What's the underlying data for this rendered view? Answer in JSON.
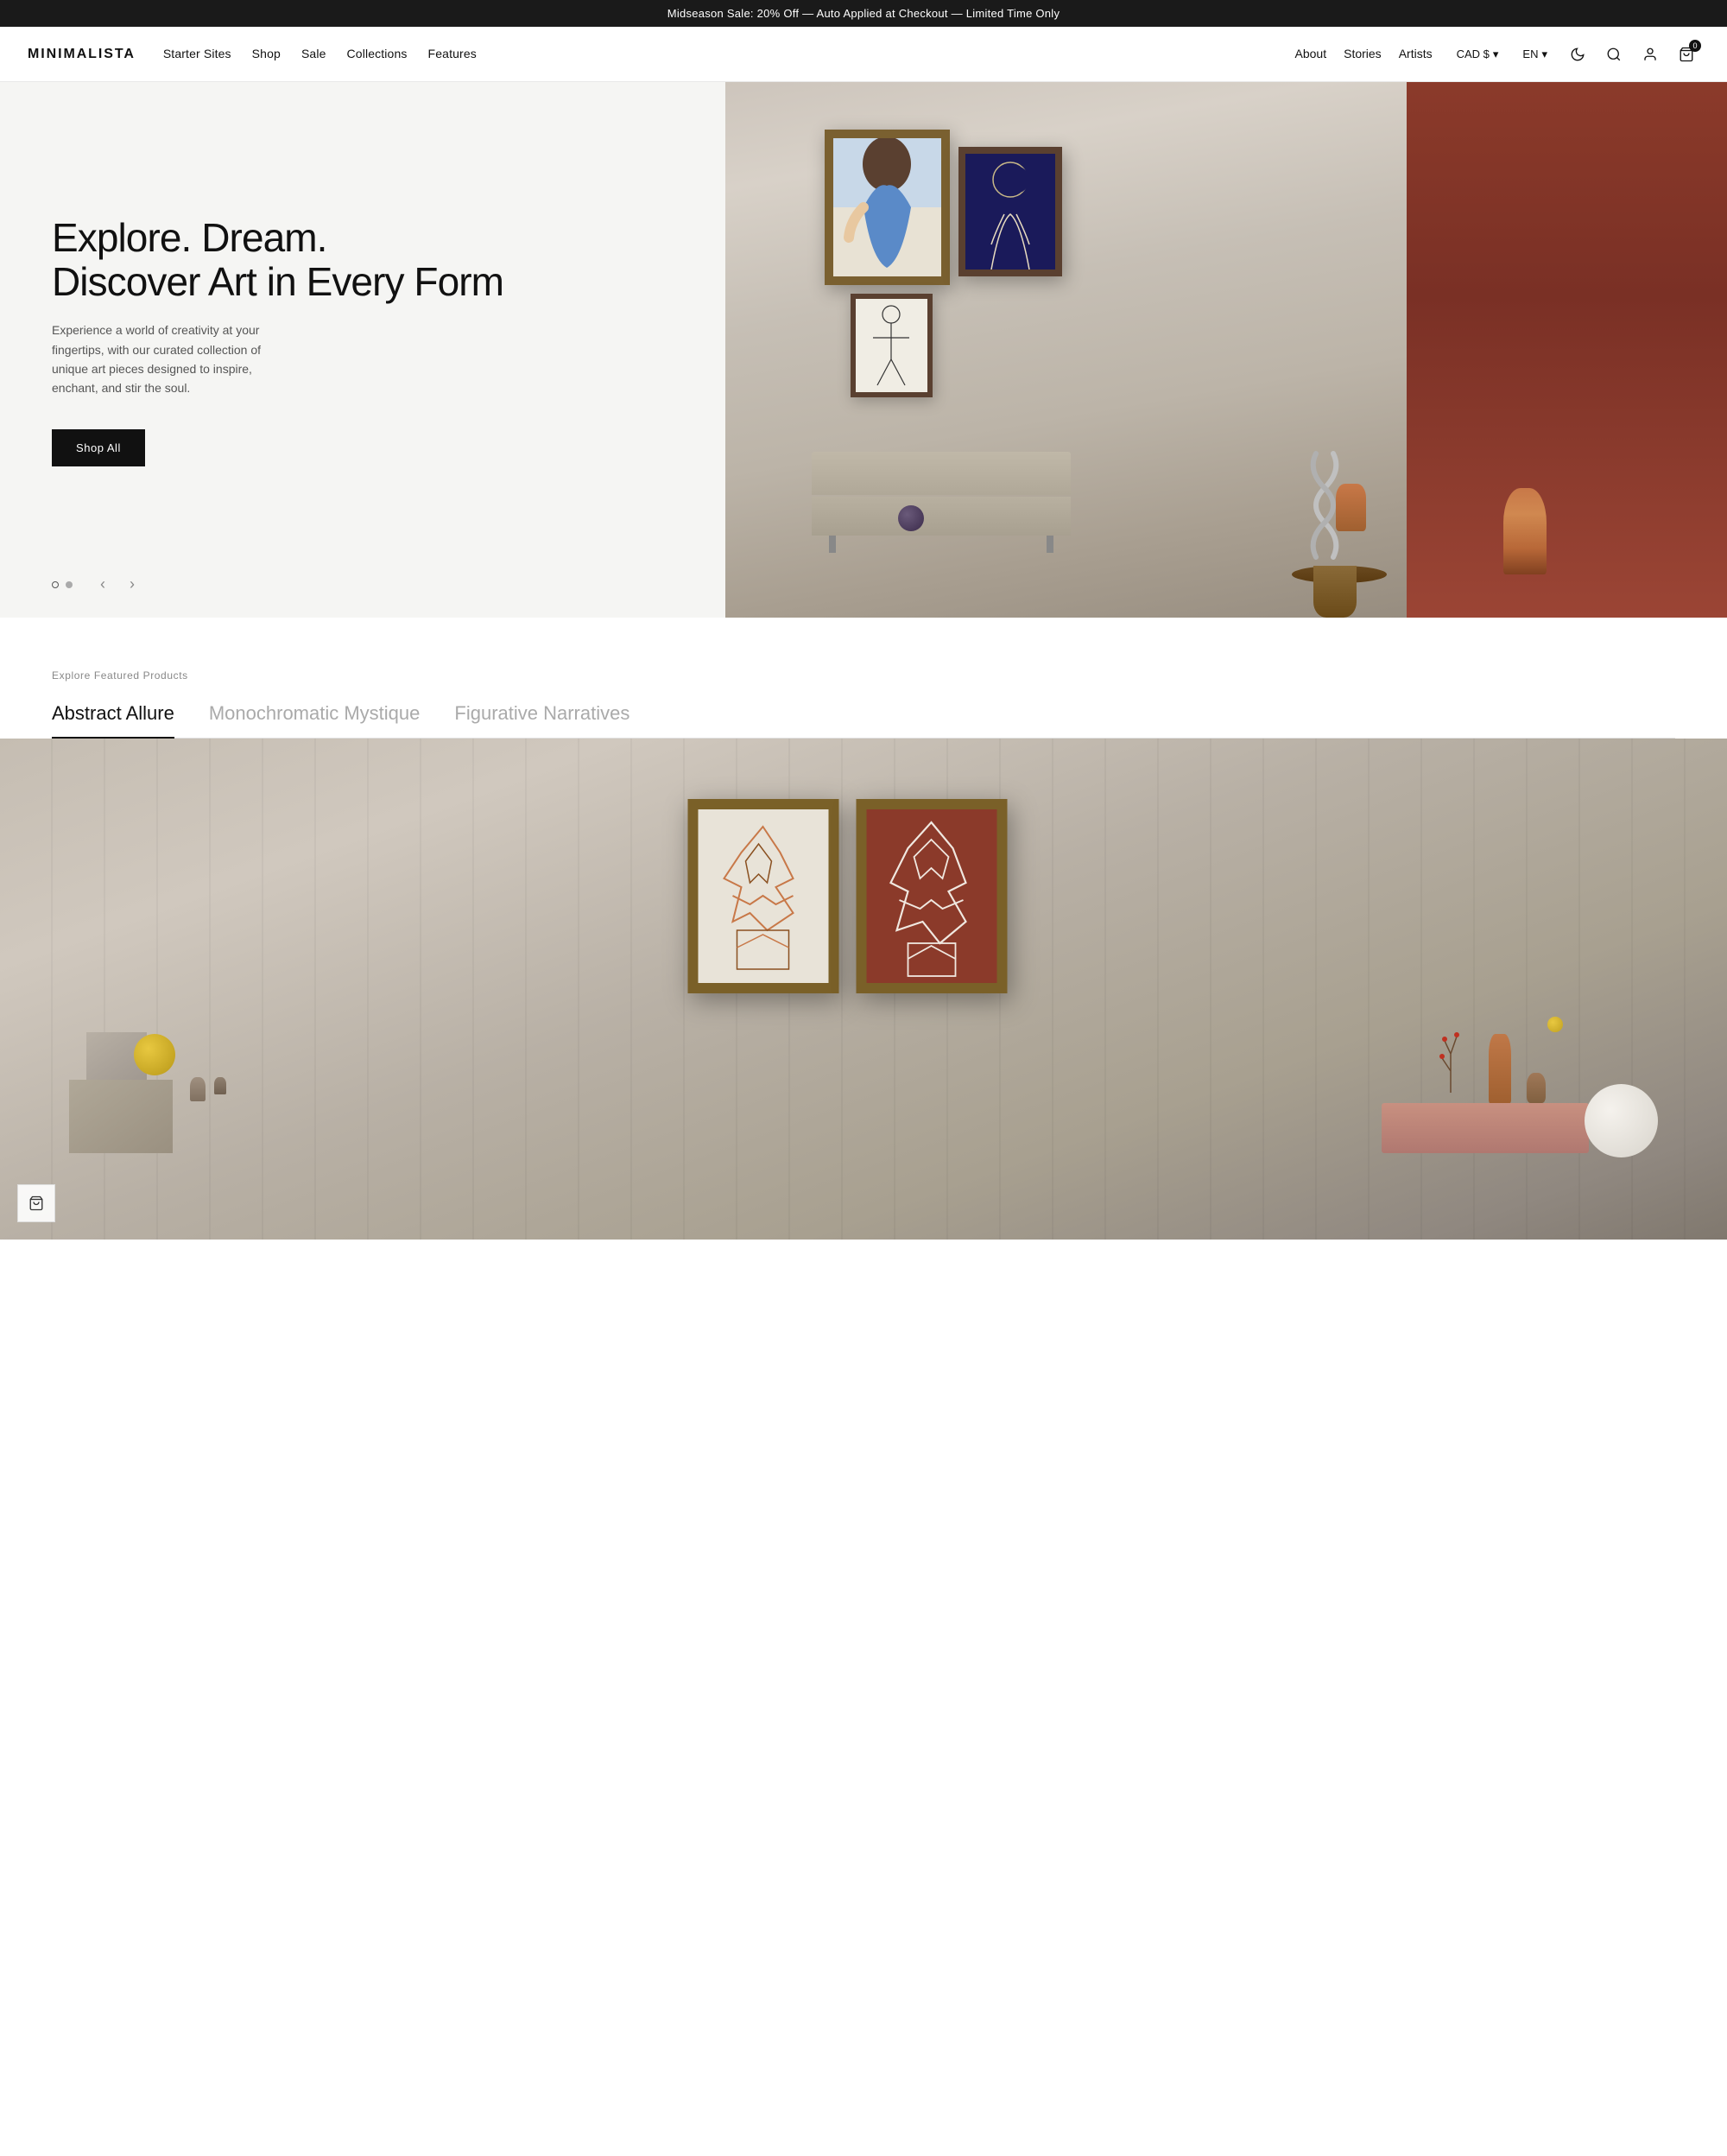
{
  "announcement": {
    "text": "Midseason Sale: 20% Off — Auto Applied at Checkout — Limited Time Only"
  },
  "header": {
    "logo": "MINIMALISTA",
    "nav_primary": [
      {
        "label": "Starter Sites",
        "href": "#"
      },
      {
        "label": "Shop",
        "href": "#"
      },
      {
        "label": "Sale",
        "href": "#"
      },
      {
        "label": "Collections",
        "href": "#"
      },
      {
        "label": "Features",
        "href": "#"
      }
    ],
    "nav_secondary": [
      {
        "label": "About",
        "href": "#"
      },
      {
        "label": "Stories",
        "href": "#"
      },
      {
        "label": "Artists",
        "href": "#"
      }
    ],
    "currency": "CAD $",
    "language": "EN",
    "cart_count": "0"
  },
  "hero": {
    "slide_1": {
      "title_line1": "Explore. Dream.",
      "title_line2": "Discover Art in Every Form",
      "description": "Experience a world of creativity at your fingertips, with our curated collection of unique art pieces designed to inspire, enchant, and stir the soul.",
      "cta_label": "Shop All"
    }
  },
  "featured": {
    "section_label": "Explore Featured Products",
    "tabs": [
      {
        "label": "Abstract Allure",
        "active": true
      },
      {
        "label": "Monochromatic Mystique",
        "active": false
      },
      {
        "label": "Figurative Narratives",
        "active": false
      }
    ]
  },
  "icons": {
    "moon": "☾",
    "search": "🔍",
    "account": "👤",
    "cart": "🛒",
    "chevron_down": "▾",
    "arrow_left": "‹",
    "arrow_right": "›",
    "cart_small": "⊕"
  }
}
